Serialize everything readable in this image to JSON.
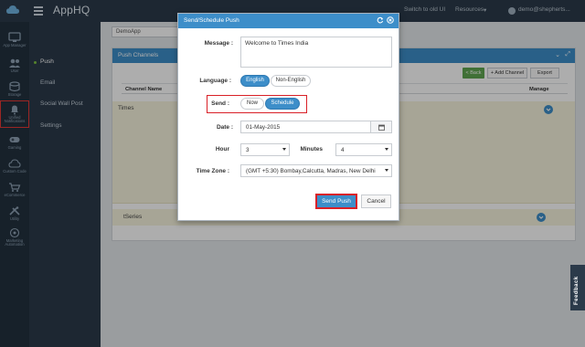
{
  "app": {
    "name": "AppHQ"
  },
  "topbar": {
    "switch_label": "Switch to old UI",
    "resources_label": "Resources",
    "user_label": "demo@shepherts..."
  },
  "iconrail": {
    "items": [
      {
        "label": "App Manager",
        "icon": "monitor-icon"
      },
      {
        "label": "User",
        "icon": "users-icon"
      },
      {
        "label": "Storage",
        "icon": "database-icon"
      },
      {
        "label": "Unified Notifications",
        "icon": "bell-icon"
      },
      {
        "label": "Gaming",
        "icon": "gamepad-icon"
      },
      {
        "label": "Custom Code",
        "icon": "cloud-code-icon"
      },
      {
        "label": "eCommerce",
        "icon": "cart-icon"
      },
      {
        "label": "Utility",
        "icon": "tools-icon"
      },
      {
        "label": "Marketing Automation",
        "icon": "marketing-icon"
      }
    ]
  },
  "subnav": {
    "items": [
      "Push",
      "Email",
      "Social Wall Post",
      "Settings"
    ]
  },
  "main": {
    "app_selected": "DemoApp",
    "panel_title": "Push Channels",
    "back_label": "< Back",
    "add_channel_label": "+ Add Channel",
    "export_label": "Export",
    "columns": [
      "Channel Name",
      "Manage"
    ],
    "rows": [
      "Times",
      "tSeries"
    ]
  },
  "modal": {
    "title": "Send/Schedule Push",
    "message_label": "Message :",
    "message_value": "Welcome to Times India",
    "language_label": "Language :",
    "language_options": [
      "English",
      "Non-English"
    ],
    "send_label": "Send :",
    "send_options": [
      "Now",
      "Schedule"
    ],
    "date_label": "Date :",
    "date_value": "01-May-2015",
    "hour_label": "Hour",
    "hour_value": "3",
    "minutes_label": "Minutes",
    "minutes_value": "4",
    "timezone_label": "Time Zone :",
    "timezone_value": "(GMT +5:30) Bombay,Calcutta, Madras, New Delhi",
    "send_push_label": "Send Push",
    "cancel_label": "Cancel"
  },
  "feedback": {
    "label": "Feedback"
  },
  "colors": {
    "accent": "#3d8ec9",
    "highlight": "#d92027",
    "sidebar": "#2b3a4a",
    "success": "#5fa550"
  }
}
